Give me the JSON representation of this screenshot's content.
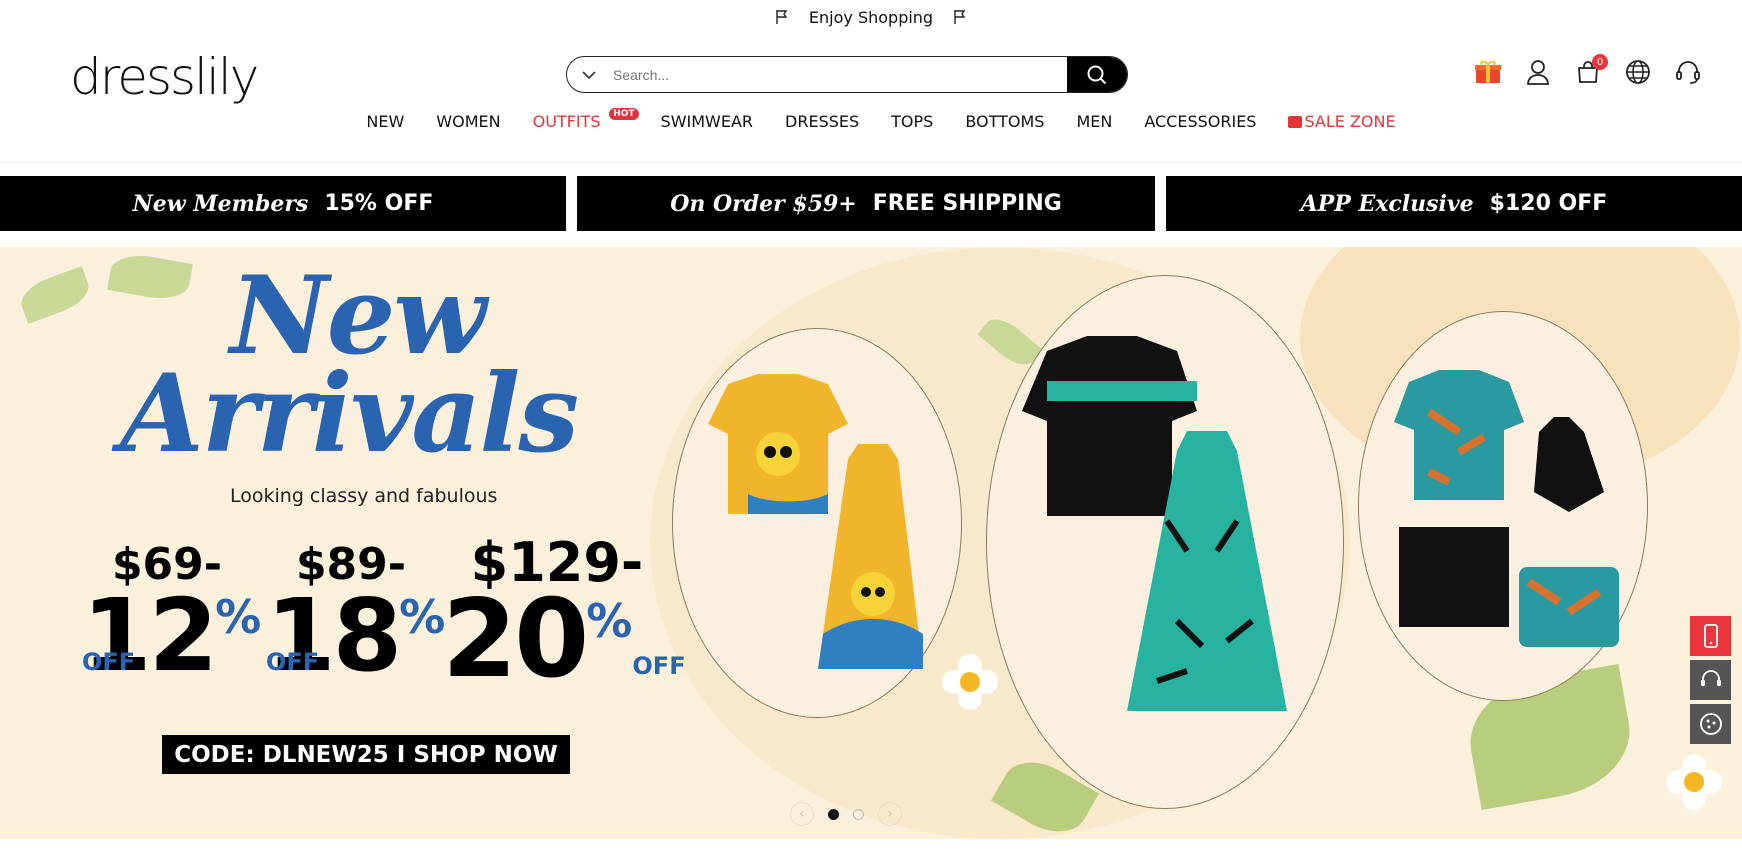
{
  "announcement": {
    "text": "Enjoy Shopping"
  },
  "header": {
    "logo": "dresslily",
    "search_placeholder": "Search...",
    "cart_count": "0"
  },
  "nav": [
    {
      "label": "NEW"
    },
    {
      "label": "WOMEN"
    },
    {
      "label": "OUTFITS",
      "badge": "HOT",
      "highlight": true
    },
    {
      "label": "SWIMWEAR"
    },
    {
      "label": "DRESSES"
    },
    {
      "label": "TOPS"
    },
    {
      "label": "BOTTOMS"
    },
    {
      "label": "MEN"
    },
    {
      "label": "ACCESSORIES"
    },
    {
      "label": "SALE ZONE",
      "highlight": true
    }
  ],
  "promos": [
    {
      "script": "New Members",
      "bold": "15% OFF"
    },
    {
      "script": "On Order $59+",
      "bold": "FREE SHIPPING"
    },
    {
      "script": "APP Exclusive",
      "bold": "$120 OFF"
    }
  ],
  "hero": {
    "title_line1": "New",
    "title_line2": "Arrivals",
    "subtitle": "Looking classy and fabulous",
    "tiers": [
      {
        "price": "$69-",
        "percent": "12",
        "sign": "%",
        "off": "OFF"
      },
      {
        "price": "$89-",
        "percent": "18",
        "sign": "%",
        "off": "OFF"
      },
      {
        "price": "$129-",
        "percent": "20",
        "sign": "%",
        "off": "OFF"
      }
    ],
    "cta": "CODE: DLNEW25 I SHOP NOW",
    "slides_total": 2,
    "active_slide": 1
  },
  "colors": {
    "accent_red": "#e3343a",
    "hero_blue": "#2a63b0",
    "hero_bg": "#fbf0dc",
    "promo_bg": "#000000"
  }
}
